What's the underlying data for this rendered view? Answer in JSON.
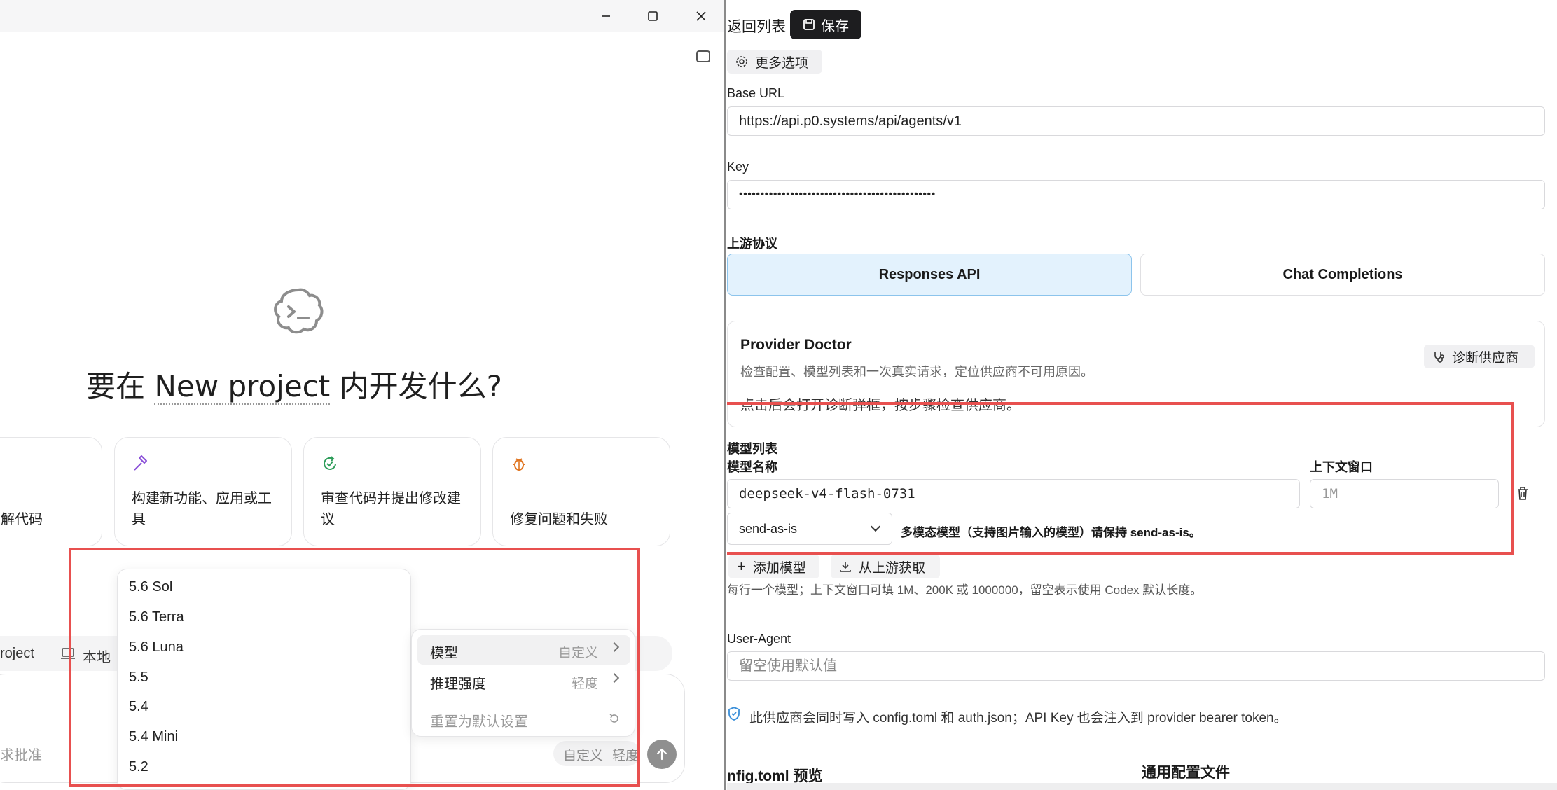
{
  "left": {
    "window_buttons": [
      "minimize",
      "maximize",
      "close"
    ],
    "headline_prefix": "要在",
    "headline_project": "New project",
    "headline_suffix": "内开发什么?",
    "cards": [
      {
        "icon": "code-icon",
        "label": "解代码",
        "color": "#555555"
      },
      {
        "icon": "hammer-icon",
        "label": "构建新功能、应用或工具",
        "color": "#8a4fd8"
      },
      {
        "icon": "review-icon",
        "label": "审查代码并提出修改建议",
        "color": "#2e9d5a"
      },
      {
        "icon": "bug-icon",
        "label": "修复问题和失败",
        "color": "#e0741f"
      }
    ],
    "toolbar": {
      "project": "roject",
      "local": "本地"
    },
    "composer": {
      "approval": "求批准",
      "mode": "自定义",
      "effort": "轻度"
    },
    "model_list": [
      "5.6 Sol",
      "5.6 Terra",
      "5.6 Luna",
      "5.5",
      "5.4",
      "5.4 Mini",
      "5.2"
    ],
    "context_menu": {
      "model_label": "模型",
      "model_value": "自定义",
      "effort_label": "推理强度",
      "effort_value": "轻度",
      "reset_label": "重置为默认设置"
    }
  },
  "right": {
    "back_label": "返回列表",
    "save_label": "保存",
    "more_options": "更多选项",
    "base_url_label": "Base URL",
    "base_url_value": "https://api.p0.systems/api/agents/v1",
    "key_label": "Key",
    "key_value": "••••••••••••••••••••••••••••••••••••••••••••••",
    "protocol_label": "上游协议",
    "protocol_options": [
      "Responses API",
      "Chat Completions"
    ],
    "protocol_selected": "Responses API",
    "doctor": {
      "title": "Provider Doctor",
      "desc": "检查配置、模型列表和一次真实请求，定位供应商不可用原因。",
      "hint": "点击后会打开诊断弹框，按步骤检查供应商。",
      "button": "诊断供应商"
    },
    "models": {
      "section_label": "模型列表",
      "name_header": "模型名称",
      "context_header": "上下文窗口",
      "name_value": "deepseek-v4-flash-0731",
      "context_placeholder": "1M",
      "mode_value": "send-as-is",
      "mode_note": "多模态模型（支持图片输入的模型）请保持 send-as-is。"
    },
    "add_model": "添加模型",
    "fetch_upstream": "从上游获取",
    "help_text": "每行一个模型；上下文窗口可填 1M、200K 或 1000000，留空表示使用 Codex 默认长度。",
    "ua_label": "User-Agent",
    "ua_placeholder": "留空使用默认值",
    "notice": "此供应商会同时写入 config.toml 和 auth.json；API Key 也会注入到 provider bearer token。",
    "preview_label": "nfig.toml 预览",
    "common_config_label": "通用配置文件"
  }
}
